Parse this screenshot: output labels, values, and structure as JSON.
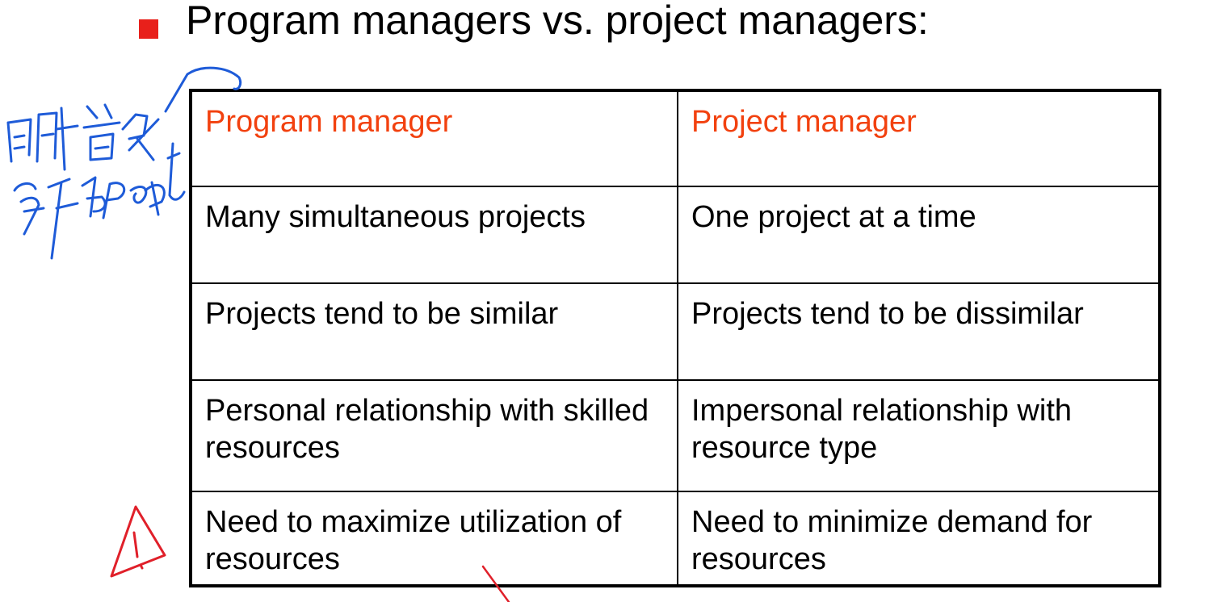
{
  "heading": {
    "text": "Program managers vs. project managers:",
    "bullet_color": "#e8201b"
  },
  "table": {
    "header": [
      "Program manager",
      "Project manager"
    ],
    "header_color": "#f2410f",
    "rows": [
      [
        "Many simultaneous projects",
        "One project at a time"
      ],
      [
        "Projects tend to be similar",
        "Projects tend to be dissimilar"
      ],
      [
        "Personal relationship with skilled resources",
        "Impersonal relationship with resource type"
      ],
      [
        "Need to maximize utilization of resources",
        "Need to minimize demand for resources"
      ]
    ]
  },
  "annotations": {
    "note_line1": "同时管很",
    "note_line2": "多个project",
    "note_color": "#1e5bd8",
    "warning_color": "#e0202a"
  }
}
